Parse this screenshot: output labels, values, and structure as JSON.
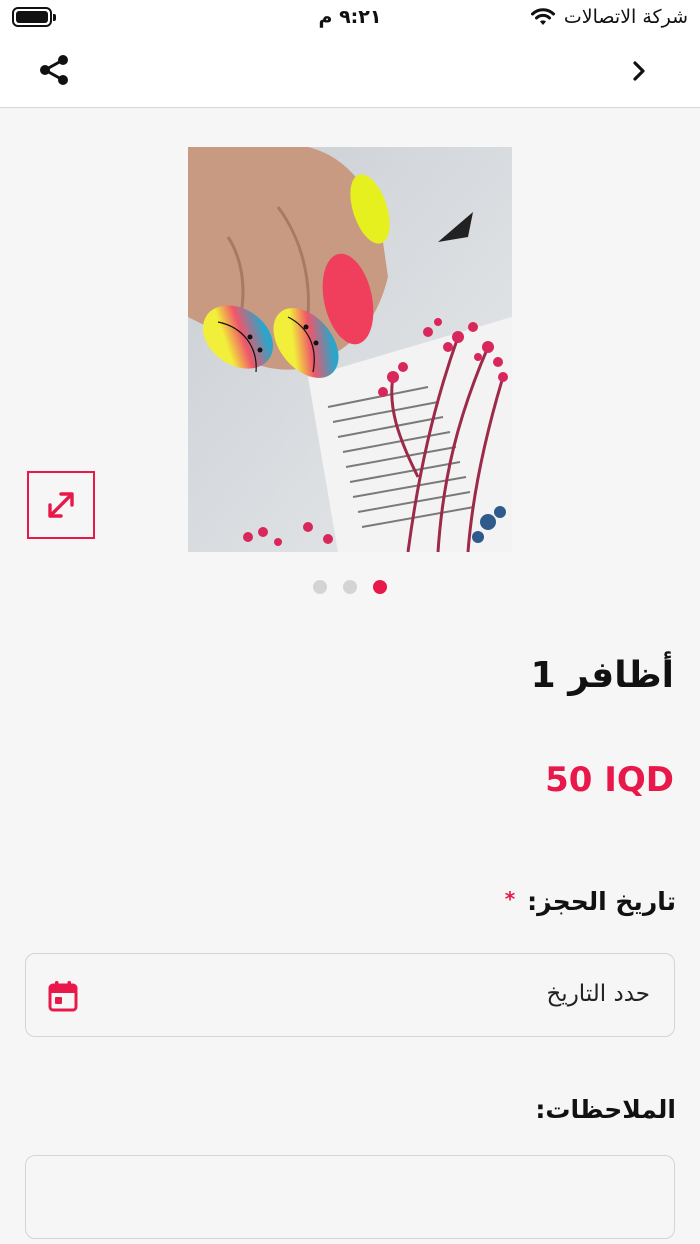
{
  "status_bar": {
    "time": "٩:٢١ م",
    "carrier": "شركة الاتصالات",
    "icons": [
      "battery-icon",
      "wifi-icon"
    ]
  },
  "nav": {
    "icons": [
      "share-icon",
      "chevron-right-icon"
    ]
  },
  "gallery": {
    "image_description_icon": "nail-art-photo",
    "expand_icon": "expand-icon",
    "page_count": 3,
    "active_page": 3
  },
  "product": {
    "title": "أظافر 1",
    "price": "50 IQD"
  },
  "booking": {
    "date_label": "تاريخ الحجز:",
    "required_marker": "*",
    "date_placeholder": "حدد التاريخ",
    "calendar_icon": "calendar-icon"
  },
  "notes": {
    "label": "الملاحظات:",
    "value": ""
  },
  "colors": {
    "accent": "#e8194a",
    "background": "#f6f6f6",
    "bar": "#ffffff"
  }
}
